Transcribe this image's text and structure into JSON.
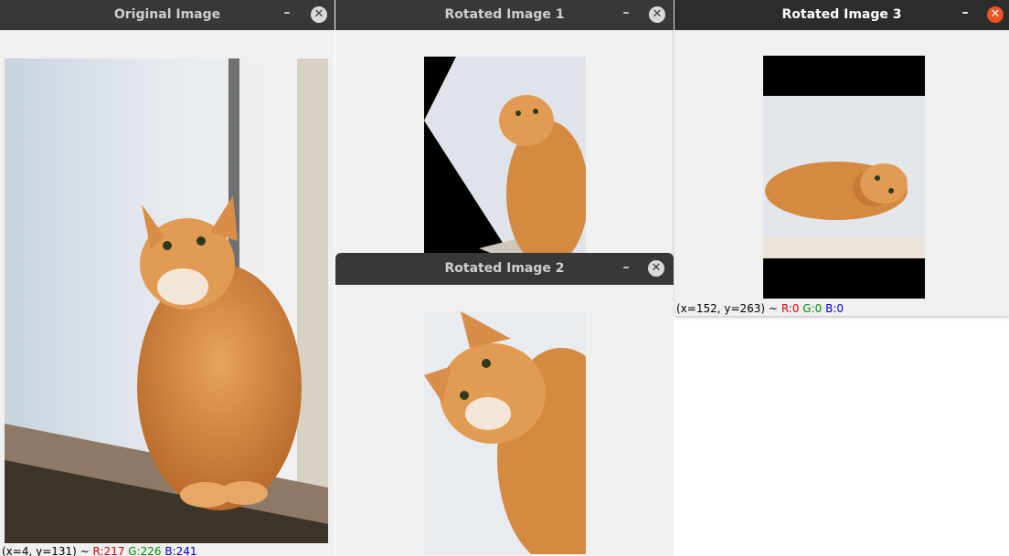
{
  "windows": {
    "original": {
      "title": "Original Image",
      "status": {
        "coords": "(x=4, y=131) ~",
        "r": "R:217",
        "g": "G:226",
        "b": "B:241"
      }
    },
    "rot1": {
      "title": "Rotated Image 1"
    },
    "rot2": {
      "title": "Rotated Image 2"
    },
    "rot3": {
      "title": "Rotated Image 3",
      "status": {
        "coords": "(x=152, y=263) ~",
        "r": "R:0",
        "g": "G:0",
        "b": "B:0"
      }
    }
  },
  "controls": {
    "minimize": "–",
    "close": "✕"
  },
  "colors": {
    "titlebar": "#383838",
    "close_active": "#e95420",
    "window_bg": "#f0f0f0"
  }
}
